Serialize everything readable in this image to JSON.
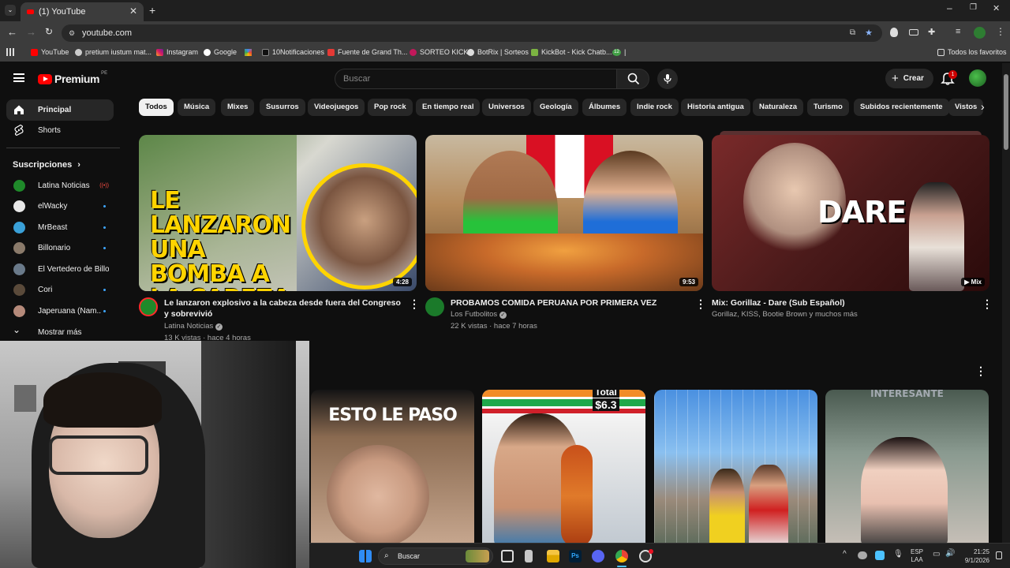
{
  "browser": {
    "tab_title": "(1) YouTube",
    "url": "youtube.com",
    "bookmarks": [
      "YouTube",
      "pretium iustum mat...",
      "Instagram",
      "Google",
      "10Notificaciones",
      "Fuente de Grand Th...",
      "SORTEO KICK",
      "BotRix | Sorteos",
      "KickBot - Kick Chatb...",
      "12"
    ],
    "all_bookmarks": "Todos los favoritos"
  },
  "header": {
    "logo": "Premium",
    "region": "PE",
    "search_placeholder": "Buscar",
    "create_label": "Crear",
    "notif_count": "1"
  },
  "sidebar": {
    "items": [
      {
        "label": "Principal"
      },
      {
        "label": "Shorts"
      }
    ],
    "subs_title": "Suscripciones",
    "subs": [
      {
        "label": "Latina Noticias",
        "color": "#1f8a2a"
      },
      {
        "label": "elWacky",
        "color": "#e8e8e8"
      },
      {
        "label": "MrBeast",
        "color": "#3aa0d8"
      },
      {
        "label": "Billonario",
        "color": "#8a7a6a"
      },
      {
        "label": "El Vertedero de Billo",
        "color": "#6a7a8a"
      },
      {
        "label": "Cori",
        "color": "#5a4a3a"
      },
      {
        "label": "Japeruana (Nam...",
        "color": "#b58a7a"
      }
    ],
    "show_more": "Mostrar más"
  },
  "chips": [
    "Todos",
    "Música",
    "Mixes",
    "Susurros",
    "Videojuegos",
    "Pop rock",
    "En tiempo real",
    "Universos",
    "Geología",
    "Álbumes",
    "Indie rock",
    "Historia antigua",
    "Naturaleza",
    "Turismo",
    "Subidos recientemente",
    "Vistos"
  ],
  "videos": [
    {
      "title": "Le lanzaron explosivo a la cabeza desde fuera del Congreso y sobrevivió",
      "channel": "Latina Noticias",
      "meta": "13 K vistas · hace 4 horas",
      "duration": "4:28",
      "thumb_text": "LE LANZARON UNA BOMBA A LA CABEZA"
    },
    {
      "title": "PROBAMOS COMIDA PERUANA POR PRIMERA VEZ",
      "channel": "Los Futbolitos",
      "meta": "22 K vistas · hace 7 horas",
      "duration": "9:53"
    },
    {
      "title": "Mix: Gorillaz - Dare (Sub Español)",
      "channel": "Gorillaz, KISS, Bootie Brown y muchos más",
      "duration": "Mix",
      "thumb_text": "DARE"
    }
  ],
  "shorts": [
    {
      "thumb_text": "ESTO LE PASO"
    },
    {
      "thumb_text": "Total",
      "price": "$6.3"
    },
    {
      "thumb_text": ""
    },
    {
      "thumb_text": "INTERESANTE"
    }
  ],
  "taskbar": {
    "search": "Buscar",
    "lang": "ESP",
    "lang2": "LAA",
    "time": "21:25",
    "date": "9/1/2026"
  }
}
